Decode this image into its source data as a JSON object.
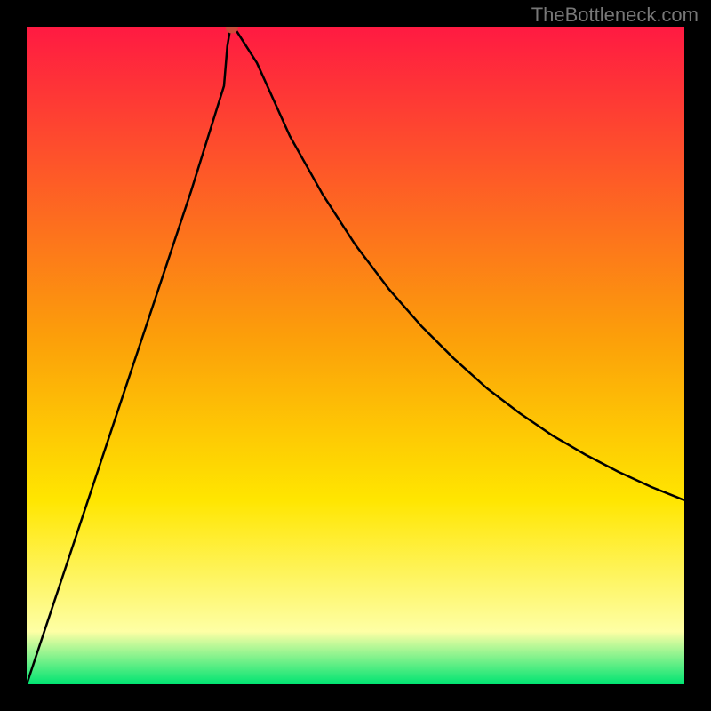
{
  "watermark": "TheBottleneck.com",
  "chart_data": {
    "type": "line",
    "title": "",
    "xlabel": "",
    "ylabel": "",
    "xlim": [
      0,
      1000
    ],
    "ylim": [
      0,
      1000
    ],
    "x": [
      0,
      25,
      50,
      75,
      100,
      125,
      150,
      175,
      200,
      225,
      250,
      275,
      300,
      305,
      310,
      315,
      320,
      350,
      400,
      450,
      500,
      550,
      600,
      650,
      700,
      750,
      800,
      850,
      900,
      950,
      1000
    ],
    "values": [
      0,
      75,
      150,
      225,
      300,
      375,
      450,
      525,
      600,
      675,
      750,
      830,
      910,
      970,
      1000,
      999,
      992,
      945,
      834,
      745,
      668,
      602,
      545,
      495,
      450,
      412,
      378,
      349,
      323,
      300,
      280
    ],
    "red_dot": {
      "x": 312,
      "y": 998
    },
    "gradient_colors": [
      "#ff1a42",
      "#fca109",
      "#ffe600",
      "#feffa5",
      "#00e472"
    ],
    "gradient_stops": [
      0,
      0.48,
      0.72,
      0.92,
      1.0
    ],
    "annotations": []
  }
}
